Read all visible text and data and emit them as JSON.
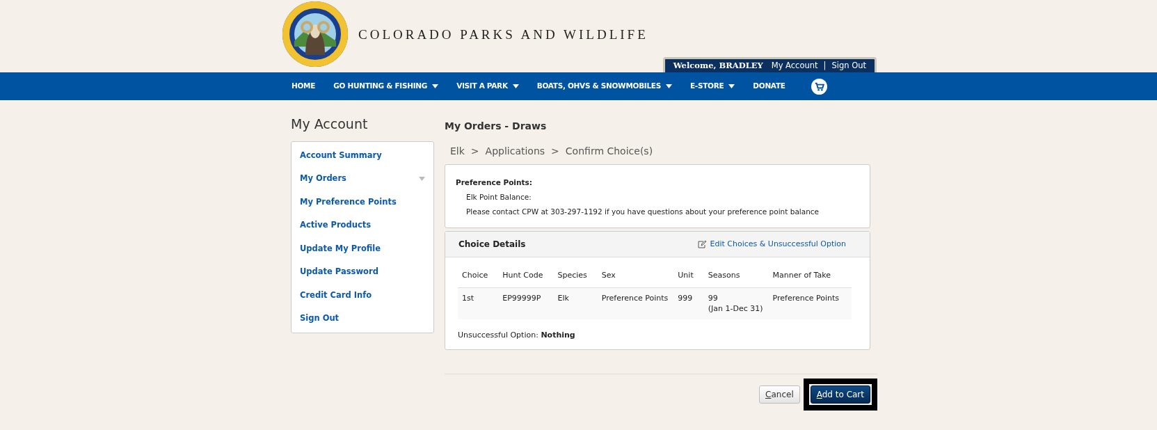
{
  "header": {
    "site_title": "COLORADO PARKS AND WILDLIFE",
    "welcome": "Welcome, BRADLEY",
    "account_link": "My Account",
    "separator": "|",
    "sign_out_link": "Sign Out"
  },
  "nav": [
    {
      "label": "HOME",
      "dropdown": false
    },
    {
      "label": "GO HUNTING & FISHING",
      "dropdown": true
    },
    {
      "label": "VISIT A PARK",
      "dropdown": true
    },
    {
      "label": "BOATS, OHVS & SNOWMOBILES",
      "dropdown": true
    },
    {
      "label": "E-STORE",
      "dropdown": true
    },
    {
      "label": "DONATE",
      "dropdown": false
    }
  ],
  "sidebar": {
    "title": "My Account",
    "items": [
      {
        "label": "Account Summary",
        "expandable": false
      },
      {
        "label": "My Orders",
        "expandable": true
      },
      {
        "label": "My Preference Points",
        "expandable": false
      },
      {
        "label": "Active Products",
        "expandable": false
      },
      {
        "label": "Update My Profile",
        "expandable": false
      },
      {
        "label": "Update Password",
        "expandable": false
      },
      {
        "label": "Credit Card Info",
        "expandable": false
      },
      {
        "label": "Sign Out",
        "expandable": false
      }
    ]
  },
  "main": {
    "title": "My Orders - Draws",
    "breadcrumb": [
      "Elk",
      "Applications",
      "Confirm Choice(s)"
    ],
    "breadcrumb_separator": ">",
    "preference_points": {
      "heading": "Preference Points:",
      "lines": [
        "Elk Point Balance:",
        "Please contact CPW at 303-297-1192 if you have questions about your preference point balance"
      ]
    },
    "choice_details": {
      "title": "Choice Details",
      "edit_link": "Edit Choices & Unsuccessful Option",
      "table": {
        "columns": [
          "Choice",
          "Hunt Code",
          "Species",
          "Sex",
          "Unit",
          "Seasons",
          "Manner of Take"
        ],
        "rows": [
          [
            [
              "1st"
            ],
            [
              "EP99999P"
            ],
            [
              "Elk"
            ],
            [
              "Preference Points"
            ],
            [
              "999"
            ],
            [
              "99",
              "(Jan 1-Dec 31)"
            ],
            [
              "Preference Points"
            ]
          ]
        ]
      },
      "unsuccessful_option": "Unsuccessful Option: **Nothing**"
    },
    "buttons": [
      {
        "label": "Cancel",
        "kind": "secondary",
        "focused": false
      },
      {
        "label": "Add to Cart",
        "kind": "primary",
        "focused": true
      }
    ]
  }
}
